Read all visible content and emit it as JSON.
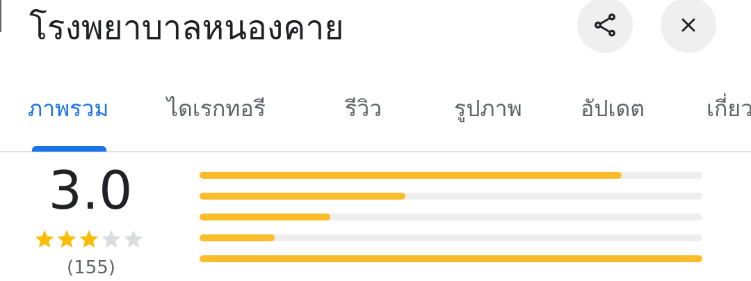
{
  "header": {
    "title": "โรงพยาบาลหนองคาย",
    "share_icon": "share-icon",
    "close_icon": "close-icon"
  },
  "tabs": [
    {
      "label": "ภาพรวม",
      "active": true
    },
    {
      "label": "ไดเรกทอรี",
      "active": false
    },
    {
      "label": "รีวิว",
      "active": false
    },
    {
      "label": "รูปภาพ",
      "active": false
    },
    {
      "label": "อัปเดต",
      "active": false
    },
    {
      "label": "เกี่ยว",
      "active": false
    }
  ],
  "rating": {
    "score": "3.0",
    "stars": 3,
    "max_stars": 5,
    "count": "(155)"
  },
  "distribution": [
    {
      "stars": 5,
      "fraction": 0.84
    },
    {
      "stars": 4,
      "fraction": 0.41
    },
    {
      "stars": 3,
      "fraction": 0.26
    },
    {
      "stars": 2,
      "fraction": 0.15
    },
    {
      "stars": 1,
      "fraction": 1.0
    }
  ],
  "colors": {
    "accent": "#1a73e8",
    "star_filled": "#fbbc04",
    "star_empty": "#dadce0",
    "bar_fill": "#fbbc2c",
    "bar_track": "#eeeeee"
  }
}
